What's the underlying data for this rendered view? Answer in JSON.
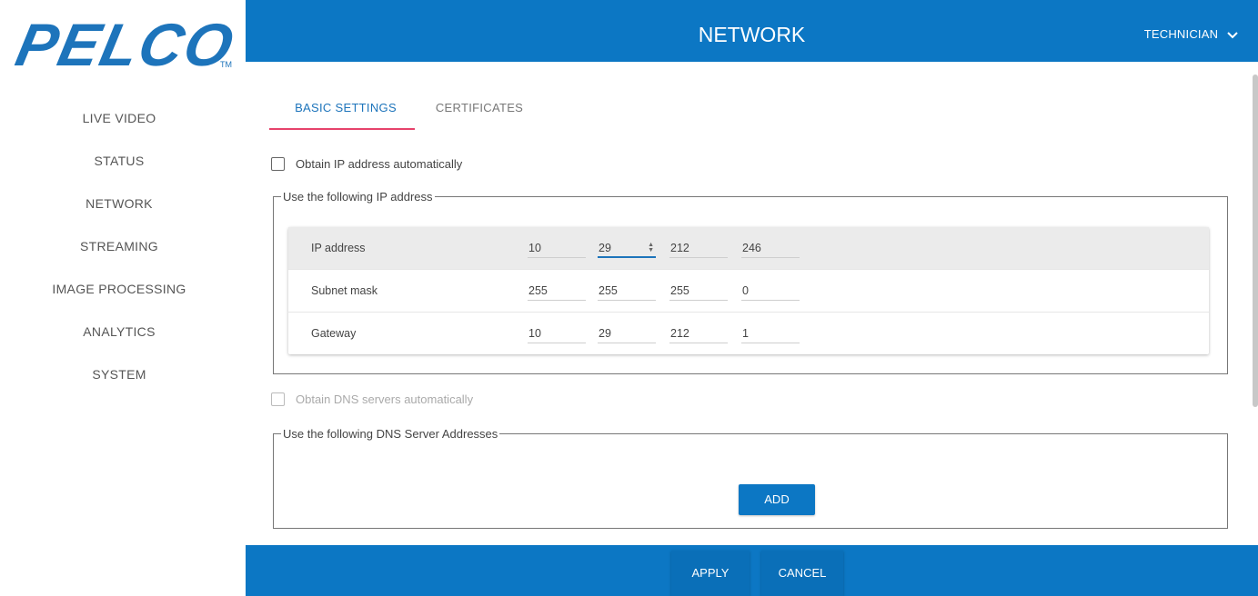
{
  "app": {
    "logo_text": "PELCO",
    "logo_tm": "TM",
    "brand_color": "#1d74bb",
    "header_color": "#0c77c4",
    "accent_tab_color": "#e6426b"
  },
  "sidebar": {
    "items": [
      {
        "label": "LIVE VIDEO"
      },
      {
        "label": "STATUS"
      },
      {
        "label": "NETWORK"
      },
      {
        "label": "STREAMING"
      },
      {
        "label": "IMAGE PROCESSING"
      },
      {
        "label": "ANALYTICS"
      },
      {
        "label": "SYSTEM"
      }
    ]
  },
  "header": {
    "title": "NETWORK",
    "user": "TECHNICIAN",
    "user_icon": "chevron-down-icon"
  },
  "tabs": [
    {
      "label": "BASIC SETTINGS",
      "active": true
    },
    {
      "label": "CERTIFICATES",
      "active": false
    }
  ],
  "ip": {
    "auto_checkbox_label": "Obtain IP address automatically",
    "auto_checked": false,
    "group_legend": "Use the following IP address",
    "rows": [
      {
        "label": "IP address",
        "octets": [
          "10",
          "29",
          "212",
          "246"
        ]
      },
      {
        "label": "Subnet mask",
        "octets": [
          "255",
          "255",
          "255",
          "0"
        ]
      },
      {
        "label": "Gateway",
        "octets": [
          "10",
          "29",
          "212",
          "1"
        ]
      }
    ]
  },
  "dns": {
    "auto_checkbox_label": "Obtain DNS servers automatically",
    "auto_checked": false,
    "auto_disabled": true,
    "group_legend": "Use the following DNS Server Addresses",
    "add_label": "ADD"
  },
  "footer": {
    "apply_label": "APPLY",
    "cancel_label": "CANCEL"
  }
}
